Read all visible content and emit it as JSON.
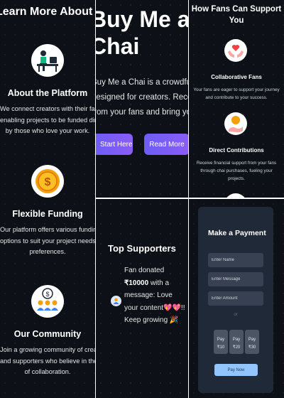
{
  "about": {
    "heading": "Learn More About Us",
    "features": [
      {
        "title": "About the Platform",
        "lines": [
          "We connect creators with their fans",
          "enabling projects to be funded directly",
          "by those who love your work."
        ],
        "icon": "person-at-desk-icon"
      },
      {
        "title": "Flexible Funding",
        "lines": [
          "Our platform offers various funding",
          "options to suit your project needs and",
          "preferences."
        ],
        "icon": "gold-coin-icon"
      },
      {
        "title": "Our Community",
        "lines": [
          "Join a growing community of creators",
          "and supporters who believe in the power",
          "of collaboration."
        ],
        "icon": "community-money-icon"
      }
    ]
  },
  "hero": {
    "title_line1": "Buy Me a",
    "title_line2": "Chai",
    "lines": [
      "Buy Me a Chai is a crowdfunding pl",
      "designed for creators. Receive direct",
      "from your fans and bring your project"
    ],
    "start_label": "Start Here",
    "read_label": "Read More"
  },
  "supporters": {
    "title": "Top Supporters",
    "message_prefix": "Fan donated",
    "amount": "₹10000",
    "message_suffix": "with a message: Love your content💖💖!! Keep growing 🎉"
  },
  "fans": {
    "heading": "How Fans Can Support You",
    "items": [
      {
        "title": "Collaborative Fans",
        "text": "Your fans are eager to support your journey and contribute to your success.",
        "icon": "hands-heart-icon"
      },
      {
        "title": "Direct Contributions",
        "text": "Receive financial support from your fans through chai purchases, fueling your projects.",
        "icon": "coin-hand-icon"
      }
    ]
  },
  "payment": {
    "title": "Make a Payment",
    "name_placeholder": "Enter Name",
    "message_placeholder": "Enter Message",
    "amount_placeholder": "Enter Amount",
    "or_text": "or",
    "amounts": [
      {
        "line1": "Pay",
        "line2": "₹10"
      },
      {
        "line1": "Pay",
        "line2": "₹20"
      },
      {
        "line1": "Pay",
        "line2": "₹30"
      }
    ],
    "pay_now_label": "Pay Now"
  },
  "colors": {
    "background": "#0d1117",
    "accent": "#8b5cf6",
    "card": "#1f2937",
    "pay_button": "#93c5fd"
  }
}
